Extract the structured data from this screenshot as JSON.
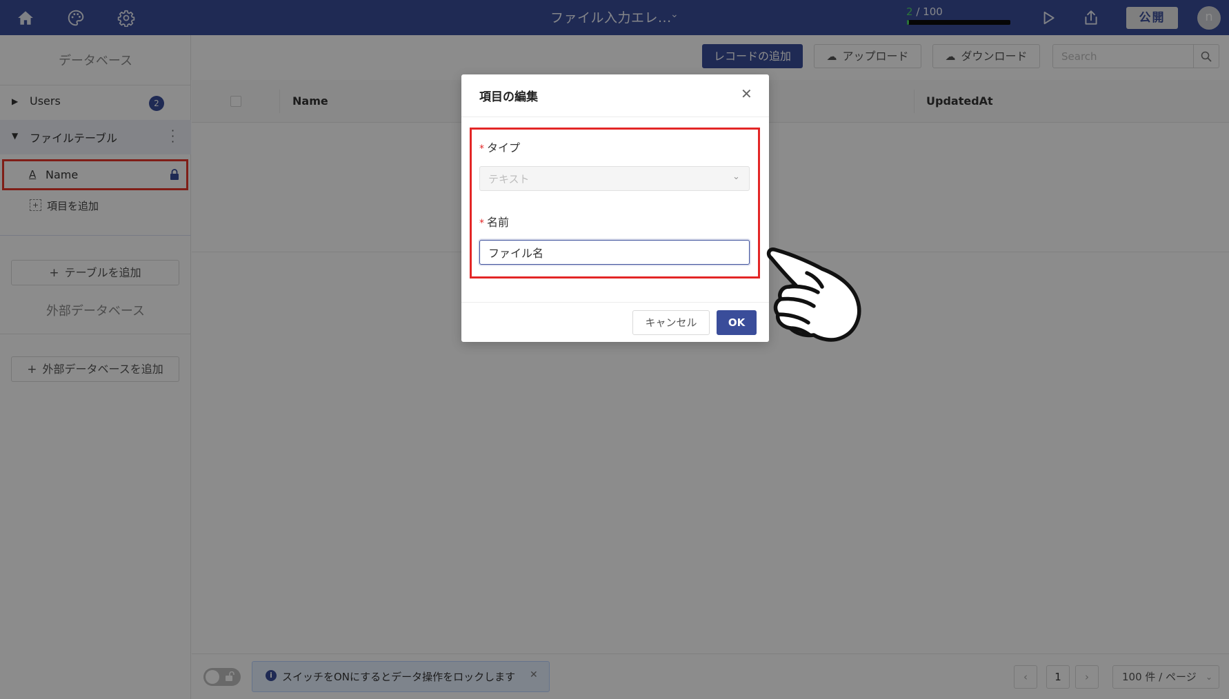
{
  "header": {
    "app_title": "ファイル入力エレ...",
    "counter_current": "2",
    "counter_total": "/ 100",
    "quota_fraction": 0.02,
    "publish_label": "公開",
    "avatar_initial": "n",
    "icons": [
      "home-icon",
      "palette-icon",
      "settings-icon",
      "chevron-down-icon",
      "play-icon",
      "share-icon"
    ]
  },
  "sidebar": {
    "title": "データベース",
    "tables": [
      {
        "label": "Users",
        "count": "2",
        "expanded": false
      },
      {
        "label": "ファイルテーブル",
        "expanded": true
      }
    ],
    "fields": [
      {
        "label": "Name",
        "type_icon": "A",
        "locked": true
      }
    ],
    "add_field_label": "項目を追加",
    "add_table_label": "テーブルを追加",
    "external_title": "外部データベース",
    "add_external_label": "外部データベースを追加"
  },
  "toolbar": {
    "add_record_label": "レコードの追加",
    "upload_label": "アップロード",
    "download_label": "ダウンロード",
    "search_placeholder": "Search"
  },
  "table": {
    "columns": [
      "Name",
      "UpdatedAt"
    ]
  },
  "footer": {
    "info_text": "スイッチをONにするとデータ操作をロックします",
    "current_page": "1",
    "page_size": "100 件 / ページ",
    "lock_switch_on": false
  },
  "modal": {
    "title": "項目の編集",
    "type_label": "タイプ",
    "type_value": "テキスト",
    "name_label": "名前",
    "name_value": "ファイル名",
    "cancel_label": "キャンセル",
    "ok_label": "OK"
  },
  "colors": {
    "brand": "#3a4d9a",
    "highlight_border": "#e32626",
    "quota_fill": "#4fd36a"
  }
}
